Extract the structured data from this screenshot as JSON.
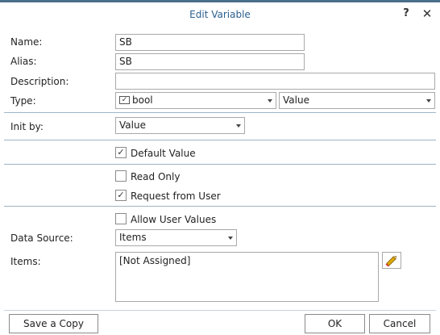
{
  "dialog": {
    "title": "Edit Variable",
    "help_label": "?",
    "close_label": "✕"
  },
  "form": {
    "name_label": "Name:",
    "name_value": "SB",
    "alias_label": "Alias:",
    "alias_value": "SB",
    "description_label": "Description:",
    "description_value": "",
    "type_label": "Type:",
    "type_value": "bool",
    "type_mode_value": "Value",
    "init_by_label": "Init by:",
    "init_by_value": "Value",
    "default_value_label": "Default Value",
    "default_value_checked": true,
    "read_only_label": "Read Only",
    "read_only_checked": false,
    "request_from_user_label": "Request from User",
    "request_from_user_checked": true,
    "allow_user_values_label": "Allow User Values",
    "allow_user_values_checked": false,
    "data_source_label": "Data Source:",
    "data_source_value": "Items",
    "items_label": "Items:",
    "items_value": "[Not Assigned]"
  },
  "buttons": {
    "save_copy": "Save a Copy",
    "ok": "OK",
    "cancel": "Cancel"
  },
  "icons": {
    "bool_type": "checkbox-type-icon",
    "edit_items": "pencil-icon"
  },
  "colors": {
    "title": "#2b5f8e",
    "separator": "#9fb4c7",
    "pencil": "#e0a800"
  }
}
